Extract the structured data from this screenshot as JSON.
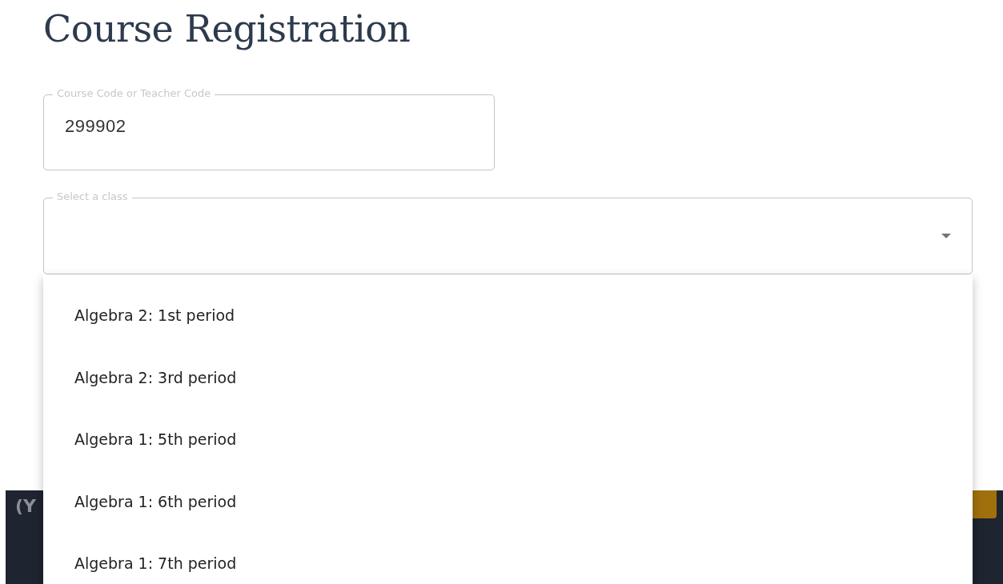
{
  "title": "Course Registration",
  "course_field": {
    "label": "Course Code or Teacher Code",
    "value": "299902"
  },
  "class_select": {
    "label": "Select a class",
    "expanded": true
  },
  "class_options": [
    {
      "label": "Algebra 2: 1st period"
    },
    {
      "label": "Algebra 2: 3rd period"
    },
    {
      "label": "Algebra 1: 5th period"
    },
    {
      "label": "Algebra 1: 6th period"
    },
    {
      "label": "Algebra 1: 7th period"
    }
  ],
  "background_banner": {
    "text": "(Y"
  }
}
